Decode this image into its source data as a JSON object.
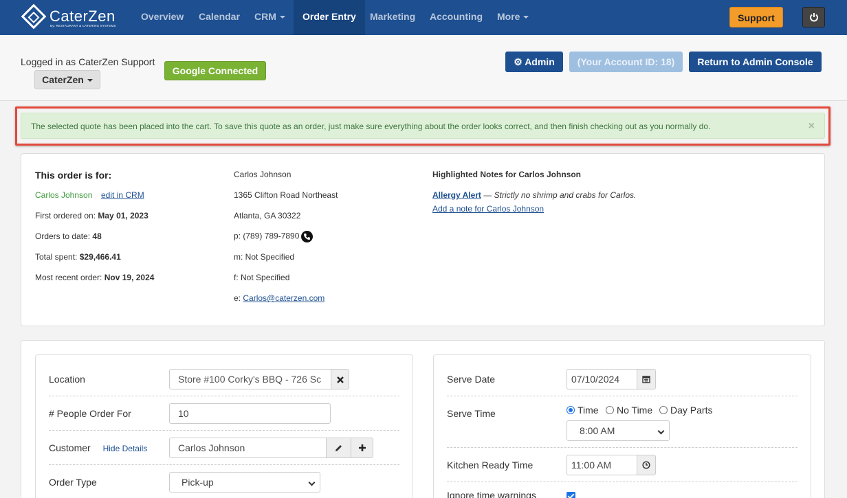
{
  "nav": {
    "brand_name": "CaterZen",
    "brand_tagline": "By: RESTAURANT & CATERING SYSTEMS",
    "items": [
      "Overview",
      "Calendar",
      "CRM",
      "Order Entry",
      "Marketing",
      "Accounting",
      "More"
    ],
    "active": "Order Entry",
    "support_label": "Support",
    "power_icon": "power-icon"
  },
  "header": {
    "logged_in": "Logged in as CaterZen Support",
    "company": "CaterZen",
    "google": "Google Connected",
    "admin": "Admin",
    "account_id": "(Your Account ID: 18)",
    "return": "Return to Admin Console"
  },
  "alert": {
    "message": "The selected quote has been placed into the cart. To save this quote as an order, just make sure everything about the order looks correct, and then finish checking out as you normally do.",
    "close": "×"
  },
  "customer": {
    "heading": "This order is for:",
    "name": "Carlos Johnson",
    "edit_link": "edit in CRM",
    "first_ordered_label": "First ordered on:",
    "first_ordered": "May 01, 2023",
    "orders_label": "Orders to date:",
    "orders": "48",
    "spent_label": "Total spent:",
    "spent": "$29,466.41",
    "recent_label": "Most recent order:",
    "recent": "Nov 19, 2024",
    "contact_name": "Carlos Johnson",
    "address1": "1365 Clifton Road Northeast",
    "address2": "Atlanta, GA 30322",
    "phone": "p: (789) 789-7890",
    "mobile": "m: Not Specified",
    "fax": "f: Not Specified",
    "email_label": "e:",
    "email": "Carlos@caterzen.com",
    "notes_heading": "Highlighted Notes for Carlos Johnson",
    "note_title": "Allergy Alert",
    "note_dash": "—",
    "note_text": "Strictly no shrimp and crabs for Carlos.",
    "add_note": "Add a note for Carlos Johnson"
  },
  "order_form": {
    "location_label": "Location",
    "location_value": "Store #100 Corky's BBQ - 726 Sc",
    "people_label": "# People Order For",
    "people_value": "10",
    "customer_label": "Customer",
    "hide_details": "Hide Details",
    "customer_value": "Carlos Johnson",
    "order_type_label": "Order Type",
    "order_type_value": "Pick-up",
    "serve_date_label": "Serve Date",
    "serve_date_value": "07/10/2024",
    "serve_time_label": "Serve Time",
    "time_options": [
      "Time",
      "No Time",
      "Day Parts"
    ],
    "time_selected": "Time",
    "serve_time_value": "8:00 AM",
    "kitchen_label": "Kitchen Ready Time",
    "kitchen_value": "11:00 AM",
    "ignore_label": "Ignore time warnings",
    "ignore_checked": true
  }
}
